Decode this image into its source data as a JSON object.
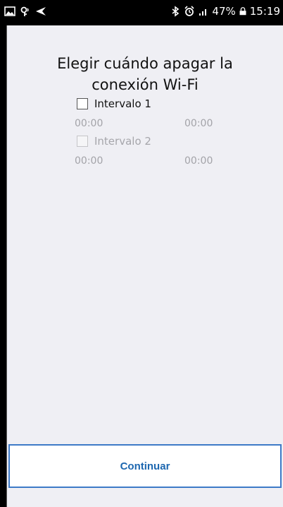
{
  "status_bar": {
    "left_icons": [
      "image-icon",
      "vpn-key-icon",
      "send-icon"
    ],
    "right_icons": [
      "bluetooth-icon",
      "alarm-icon",
      "signal-icon"
    ],
    "battery": "47%",
    "lock_icon": "lock-icon",
    "time": "15:19"
  },
  "title": {
    "line1": "Elegir cuándo apagar la",
    "line2": "conexión Wi-Fi"
  },
  "intervals": [
    {
      "label": "Intervalo 1",
      "checked": false,
      "enabled": true,
      "start": "00:00",
      "end": "00:00"
    },
    {
      "label": "Intervalo 2",
      "checked": false,
      "enabled": false,
      "start": "00:00",
      "end": "00:00"
    }
  ],
  "footer": {
    "continue_label": "Continuar"
  },
  "colors": {
    "accent": "#1d67b0",
    "border": "#3d7ac7",
    "background": "#efeff4",
    "muted": "#a3a3a8"
  }
}
